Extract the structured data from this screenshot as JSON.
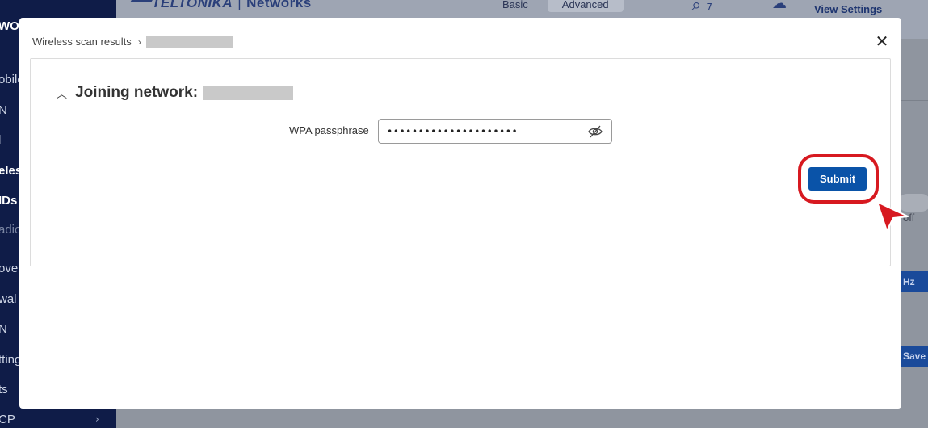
{
  "background_app": {
    "sidebar_fragments": [
      "WO",
      "obile",
      "N",
      "l",
      "eles",
      "IDs",
      "adio",
      "ove",
      "wal",
      "N",
      "tting",
      "ts",
      "CP"
    ],
    "brand": {
      "name": "TELTONIKA",
      "sub": "Networks"
    },
    "mode_tabs": [
      "Basic",
      "Advanced"
    ],
    "search_count": "7",
    "view_settings": "View Settings",
    "toggle_state": "off",
    "band_fragment": "Hz",
    "save_fragment": "Save &"
  },
  "modal": {
    "breadcrumb": {
      "parent": "Wireless scan results",
      "current_redacted": true
    },
    "close_glyph": "✕",
    "section": {
      "title": "Joining network:",
      "network_redacted": true
    },
    "form": {
      "passphrase_label": "WPA passphrase",
      "passphrase_value": "•••••••••••••••••••••"
    },
    "submit_label": "Submit"
  },
  "annotation": {
    "highlight_color": "#d71920",
    "icon": "cursor-arrow-icon"
  },
  "colors": {
    "primary": "#0a53a8",
    "sidebar": "#0f1c48",
    "overlay_bg": "#8f959f"
  }
}
